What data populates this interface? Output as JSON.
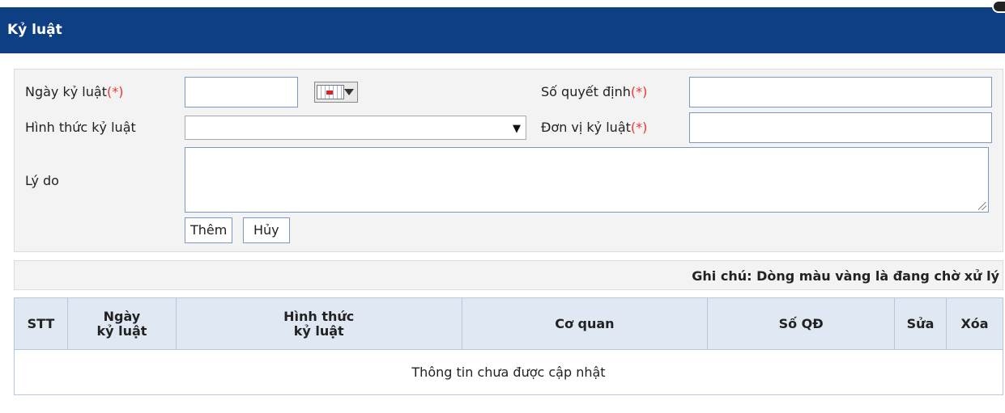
{
  "window": {
    "title": "Kỷ luật"
  },
  "form": {
    "date_label": "Ngày kỷ luật",
    "date_required": "(*)",
    "date_value": "",
    "decision_label": "Số quyết định",
    "decision_required": "(*)",
    "decision_value": "",
    "type_label": "Hình thức kỷ luật",
    "type_selected": "",
    "unit_label": "Đơn vị kỷ luật",
    "unit_required": "(*)",
    "unit_value": "",
    "reason_label": "Lý do",
    "reason_value": "",
    "add_button": "Thêm",
    "cancel_button": "Hủy"
  },
  "note": "Ghi chú: Dòng màu vàng là đang chờ xử lý",
  "table": {
    "columns": {
      "stt": "STT",
      "date_line1": "Ngày",
      "date_line2": "kỷ luật",
      "type_line1": "Hình thức",
      "type_line2": "kỷ luật",
      "agency": "Cơ quan",
      "decision_no": "Số QĐ",
      "edit": "Sửa",
      "delete": "Xóa"
    },
    "empty_message": "Thông tin chưa được cập nhật"
  },
  "colors": {
    "title_bar": "#0f3f83",
    "required": "#e33333",
    "header_bg": "#dfe8f3"
  },
  "icons": {
    "calendar": "calendar-icon",
    "dropdown": "chevron-down-icon",
    "close": "close-icon"
  }
}
